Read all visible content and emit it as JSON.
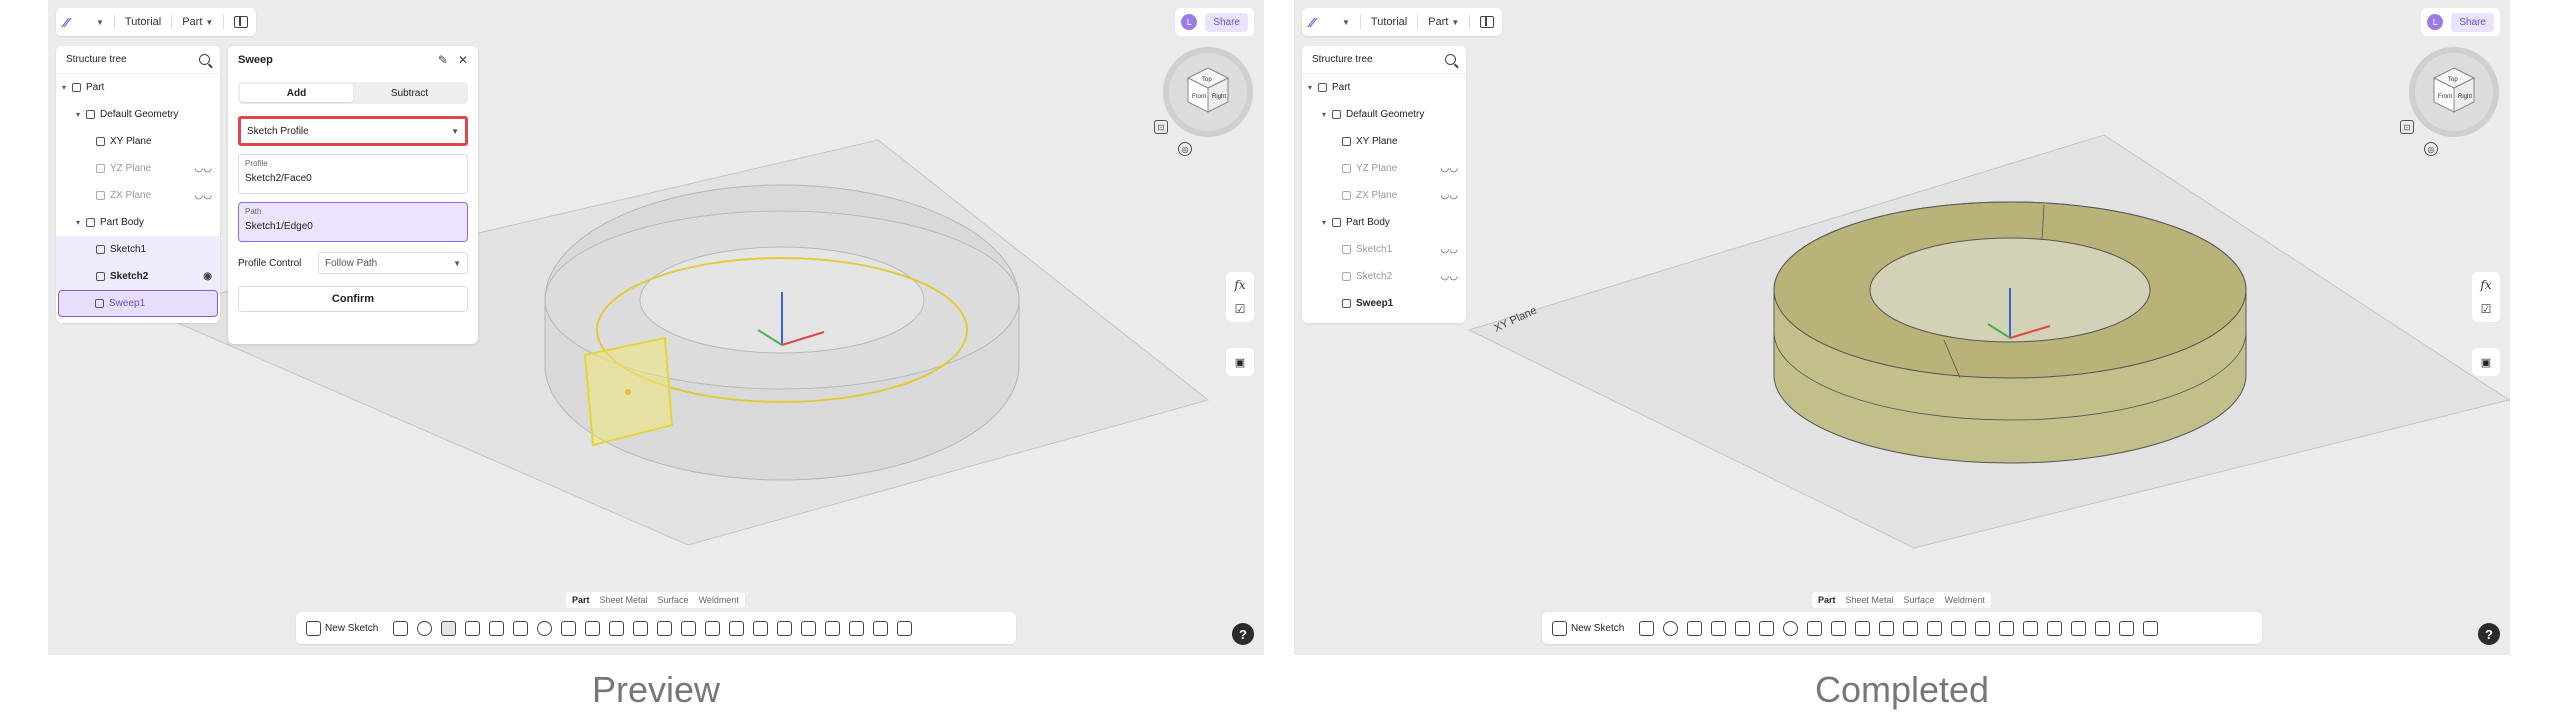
{
  "panels": [
    {
      "caption": "Preview",
      "topbar": {
        "logo": "∕∕",
        "project": "Tutorial",
        "mode": "Part"
      },
      "share": {
        "avatar": "L",
        "label": "Share"
      },
      "tree": {
        "title": "Structure tree",
        "items": [
          {
            "label": "Part"
          },
          {
            "label": "Default Geometry"
          },
          {
            "label": "XY Plane"
          },
          {
            "label": "YZ Plane"
          },
          {
            "label": "ZX Plane"
          },
          {
            "label": "Part Body"
          },
          {
            "label": "Sketch1"
          },
          {
            "label": "Sketch2"
          },
          {
            "label": "Sweep1"
          }
        ]
      },
      "dialog": {
        "title": "Sweep",
        "add_label": "Add",
        "subtract_label": "Subtract",
        "profile_select": "Sketch Profile",
        "profile_label": "Profile",
        "profile_value": "Sketch2/Face0",
        "path_label": "Path",
        "path_value": "Sketch1/Edge0",
        "control_label": "Profile Control",
        "control_value": "Follow Path",
        "confirm_label": "Confirm"
      },
      "viewcube": {
        "front": "Front",
        "right": "Right",
        "top": "Top"
      },
      "tabs": [
        "Part",
        "Sheet Metal",
        "Surface",
        "Weldment"
      ],
      "toolbar": {
        "new_sketch": "New Sketch"
      },
      "fx": "fx",
      "help": "?"
    },
    {
      "caption": "Completed",
      "topbar": {
        "logo": "∕∕",
        "project": "Tutorial",
        "mode": "Part"
      },
      "share": {
        "avatar": "L",
        "label": "Share"
      },
      "tree": {
        "title": "Structure tree",
        "items": [
          {
            "label": "Part"
          },
          {
            "label": "Default Geometry"
          },
          {
            "label": "XY Plane"
          },
          {
            "label": "YZ Plane"
          },
          {
            "label": "ZX Plane"
          },
          {
            "label": "Part Body"
          },
          {
            "label": "Sketch1"
          },
          {
            "label": "Sketch2"
          },
          {
            "label": "Sweep1"
          }
        ]
      },
      "plane_label": "XY Plane",
      "viewcube": {
        "front": "Front",
        "right": "Right",
        "top": "Top"
      },
      "tabs": [
        "Part",
        "Sheet Metal",
        "Surface",
        "Weldment"
      ],
      "toolbar": {
        "new_sketch": "New Sketch"
      },
      "fx": "fx",
      "help": "?"
    }
  ]
}
